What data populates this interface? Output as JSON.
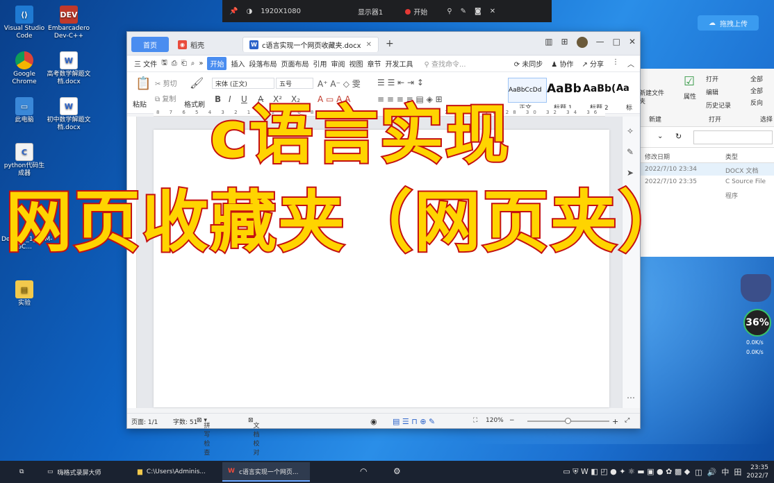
{
  "desktop": {
    "icons": [
      {
        "label": "Visual Studio Code",
        "color": "#1f7ad2"
      },
      {
        "label": "Embarcadero Dev-C++",
        "color": "#c0392b",
        "badge": "DEV"
      },
      {
        "label": "Google Chrome",
        "color": "#e0a51f"
      },
      {
        "label": "高考数学解题文档.docx",
        "color": "#2a62c9",
        "badge": "W"
      },
      {
        "label": "此电脑",
        "color": "#3a88d8"
      },
      {
        "label": "初中数学解题文档.docx",
        "color": "#2a62c9",
        "badge": "W"
      },
      {
        "label": "python代码生成器",
        "color": "#e7e7e7"
      },
      {
        "label": "De...5.1_1_TDM-GC...",
        "color": "#9b9b9b"
      },
      {
        "label": "实验",
        "color": "#f2c94c"
      }
    ]
  },
  "recorder_bar": {
    "resolution": "1920X1080",
    "display": "显示器1",
    "record": "开始"
  },
  "cloud_button": {
    "label": "拖拽上传"
  },
  "wps": {
    "tabs": {
      "home": "首页",
      "daoke": "稻壳",
      "doc": "c语言实现一个网页收藏夹.docx",
      "add": "+"
    },
    "menubar": {
      "file": "三 文件",
      "start": "开始",
      "items": [
        "插入",
        "段落布局",
        "页面布局",
        "引用",
        "审阅",
        "视图",
        "章节",
        "开发工具"
      ],
      "search": "查找命令...",
      "sync": "未同步",
      "collab": "协作",
      "share": "分享"
    },
    "toolbar": {
      "paste": "粘贴",
      "cut": "剪切",
      "copy": "复制",
      "format_painter": "格式刷",
      "font": "宋体 (正文)",
      "size": "五号",
      "styles": [
        {
          "preview": "AaBbCcDd",
          "label": "正文"
        },
        {
          "preview": "AaBb",
          "label": "标题 1"
        },
        {
          "preview": "AaBb(",
          "label": "标题 2"
        },
        {
          "preview": "Aa",
          "label": "标"
        }
      ]
    },
    "ruler_ticks": "8 7 6 5 4 3 2 1 · 2 4 6 8 10 12 14 16 18 20 22 24 26 28 30 32 34 36 38 40 42 44 46 48",
    "status": {
      "page": "页面: 1/1",
      "words": "字数: 51",
      "spell": "拼写检查",
      "proof": "文档校对",
      "zoom": "120%"
    }
  },
  "explorer": {
    "ribbon": {
      "new_folder": "新建文件夹",
      "new_group": "新建",
      "properties": "属性",
      "open": "打开",
      "edit": "编辑",
      "history": "历史记录",
      "open_group": "打开",
      "select_all": "全部",
      "select_none": "全部",
      "invert": "反向",
      "select_group": "选择"
    },
    "columns": {
      "modified": "修改日期",
      "type": "类型"
    },
    "rows": [
      {
        "date": "2022/7/10 23:34",
        "type": "DOCX 文档"
      },
      {
        "date": "2022/7/10 23:35",
        "type": "C Source File"
      },
      {
        "date": "",
        "type": "程序"
      }
    ]
  },
  "overlay": {
    "line1": "c语言实现",
    "line2": "网页收藏夹（网页夹）"
  },
  "net_widget": {
    "percent": "36%",
    "up": "0.0K/s",
    "down": "0.0K/s"
  },
  "taskbar": {
    "tasks": [
      {
        "label": "嗨格式录屏大师"
      },
      {
        "label": "C:\\Users\\Adminis..."
      },
      {
        "label": "c语言实现一个网页..."
      }
    ],
    "ime": "中",
    "grid": "田",
    "time": "23:35",
    "date": "2022/7"
  }
}
